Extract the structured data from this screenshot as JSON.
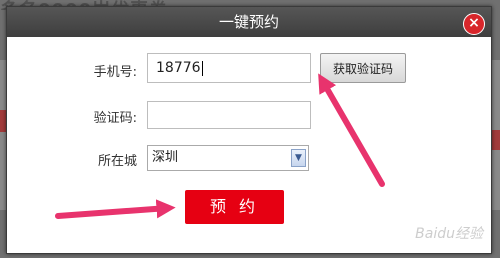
{
  "background": {
    "partial_text": "多名0000岁优惠券"
  },
  "dialog": {
    "title": "一键预约",
    "close_symbol": "×",
    "phone": {
      "label": "手机号:",
      "value": "18776"
    },
    "get_code_button": "获取验证码",
    "code": {
      "label": "验证码:",
      "value": ""
    },
    "city": {
      "label": "所在城",
      "selected": "深圳"
    },
    "submit_button": "预 约"
  },
  "watermark": "Baidu经验",
  "colors": {
    "title_bar": "#444444",
    "close": "#d8262b",
    "submit": "#e60012",
    "arrow": "#e8336d"
  }
}
